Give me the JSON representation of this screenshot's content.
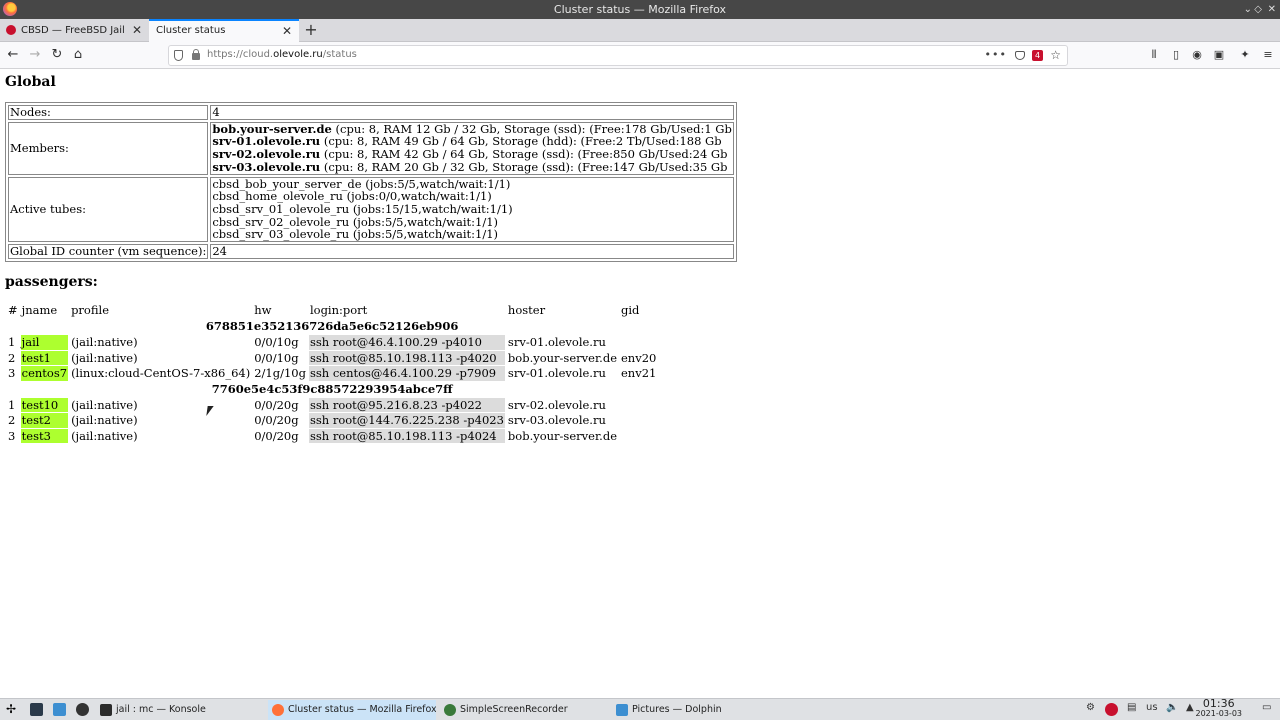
{
  "window": {
    "title": "Cluster status — Mozilla Firefox"
  },
  "tabs": [
    {
      "label": "CBSD — FreeBSD Jail and"
    },
    {
      "label": "Cluster status"
    }
  ],
  "urlbar": {
    "prefix": "https://cloud.",
    "domain": "olevole.ru",
    "path": "/status",
    "badge": "4"
  },
  "page": {
    "global_heading": "Global",
    "global": {
      "nodes_label": "Nodes:",
      "nodes_value": "4",
      "members_label": "Members:",
      "members": [
        {
          "name": "bob.your-server.de",
          "info": " (cpu: 8, RAM 12 Gb / 32 Gb, Storage (ssd): (Free:178 Gb/Used:1 Gb"
        },
        {
          "name": "srv-01.olevole.ru",
          "info": " (cpu: 8, RAM 49 Gb / 64 Gb, Storage (hdd): (Free:2 Tb/Used:188 Gb"
        },
        {
          "name": "srv-02.olevole.ru",
          "info": " (cpu: 8, RAM 42 Gb / 64 Gb, Storage (ssd): (Free:850 Gb/Used:24 Gb"
        },
        {
          "name": "srv-03.olevole.ru",
          "info": " (cpu: 8, RAM 20 Gb / 32 Gb, Storage (ssd): (Free:147 Gb/Used:35 Gb"
        }
      ],
      "tubes_label": "Active tubes:",
      "tubes": [
        "cbsd_bob_your_server_de (jobs:5/5,watch/wait:1/1)",
        "cbsd_home_olevole_ru (jobs:0/0,watch/wait:1/1)",
        "cbsd_srv_01_olevole_ru (jobs:15/15,watch/wait:1/1)",
        "cbsd_srv_02_olevole_ru (jobs:5/5,watch/wait:1/1)",
        "cbsd_srv_03_olevole_ru (jobs:5/5,watch/wait:1/1)"
      ],
      "counter_label": "Global ID counter (vm sequence):",
      "counter_value": "24"
    },
    "passengers_heading": "passengers:",
    "columns": [
      "#",
      "jname",
      "profile",
      "hw",
      "login:port",
      "hoster",
      "gid"
    ],
    "groups": [
      {
        "hash": "678851e352136726da5e6c52126eb906",
        "rows": [
          {
            "n": "1",
            "jname": "jail",
            "profile": "(jail:native)",
            "hw": "0/0/10g",
            "login": "ssh root@46.4.100.29 -p4010",
            "hoster": "srv-01.olevole.ru",
            "gid": ""
          },
          {
            "n": "2",
            "jname": "test1",
            "profile": "(jail:native)",
            "hw": "0/0/10g",
            "login": "ssh root@85.10.198.113 -p4020",
            "hoster": "bob.your-server.de",
            "gid": "env20"
          },
          {
            "n": "3",
            "jname": "centos7",
            "profile": "(linux:cloud-CentOS-7-x86_64)",
            "hw": "2/1g/10g",
            "login": "ssh centos@46.4.100.29 -p7909",
            "hoster": "srv-01.olevole.ru",
            "gid": "env21"
          }
        ]
      },
      {
        "hash": "7760e5e4c53f9c88572293954abce7ff",
        "rows": [
          {
            "n": "1",
            "jname": "test10",
            "profile": "(jail:native)",
            "hw": "0/0/20g",
            "login": "ssh root@95.216.8.23 -p4022",
            "hoster": "srv-02.olevole.ru",
            "gid": ""
          },
          {
            "n": "2",
            "jname": "test2",
            "profile": "(jail:native)",
            "hw": "0/0/20g",
            "login": "ssh root@144.76.225.238 -p4023",
            "hoster": "srv-03.olevole.ru",
            "gid": ""
          },
          {
            "n": "3",
            "jname": "test3",
            "profile": "(jail:native)",
            "hw": "0/0/20g",
            "login": "ssh root@85.10.198.113 -p4024",
            "hoster": "bob.your-server.de",
            "gid": ""
          }
        ]
      }
    ]
  },
  "taskbar": {
    "tasks": [
      {
        "label": "jail : mc — Konsole",
        "icon": "konsole-icon"
      },
      {
        "label": "Cluster status — Mozilla Firefox",
        "icon": "firefox-icon"
      },
      {
        "label": "SimpleScreenRecorder",
        "icon": "recorder-icon"
      },
      {
        "label": "Pictures — Dolphin",
        "icon": "folder-icon"
      }
    ],
    "keyboard_layout": "us",
    "time": "01:36",
    "date": "2021-03-03"
  },
  "colors": {
    "jname_bg": "#adff2f",
    "login_bg": "#dcdcdc",
    "accent": "#0a84ff"
  }
}
